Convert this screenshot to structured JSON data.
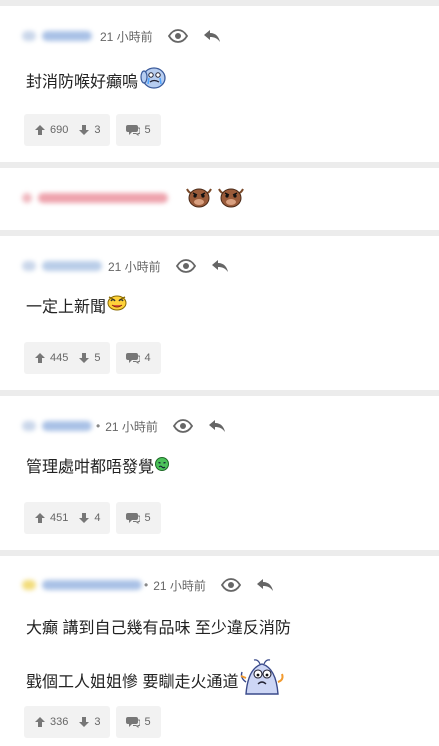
{
  "posts": [
    {
      "time": "21 小時前",
      "text_lines": [
        "封消防喉好癲嗚"
      ],
      "upvotes": "690",
      "downvotes": "3",
      "replies": "5"
    },
    {
      "time": "",
      "text_lines": [],
      "upvotes": "",
      "downvotes": "",
      "replies": ""
    },
    {
      "time": "21 小時前",
      "text_lines": [
        "一定上新聞"
      ],
      "upvotes": "445",
      "downvotes": "5",
      "replies": "4"
    },
    {
      "time": "21 小時前",
      "text_lines": [
        "管理處咁都唔發覺"
      ],
      "upvotes": "451",
      "downvotes": "4",
      "replies": "5"
    },
    {
      "time": "21 小時前",
      "text_lines": [
        "大癲 講到自己幾有品味 至少違反消防",
        "戥個工人姐姐慘 要瞓走火通道"
      ],
      "upvotes": "336",
      "downvotes": "3",
      "replies": "5"
    }
  ],
  "separator": "•",
  "colors": {
    "page_bg": "#ececec",
    "card_bg": "#ffffff",
    "pill_bg": "#f2f2f2",
    "muted": "#666666"
  }
}
